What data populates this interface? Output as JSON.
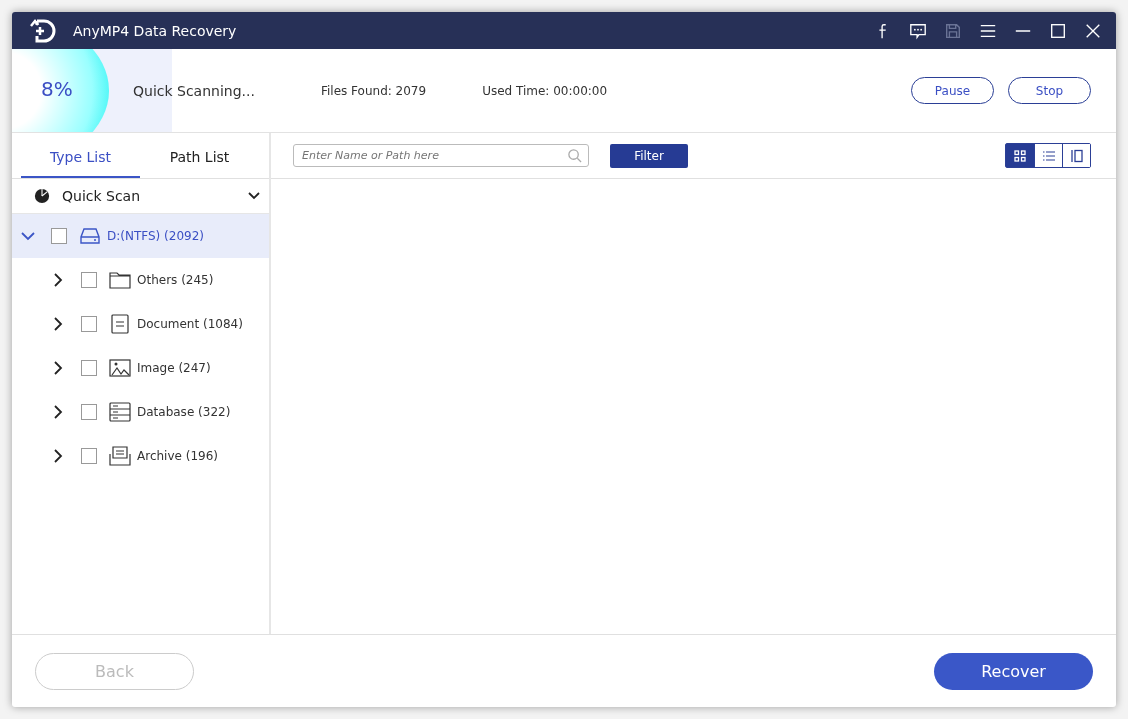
{
  "window": {
    "title": "AnyMP4 Data Recovery"
  },
  "scan": {
    "percent": "8%",
    "status": "Quick Scanning...",
    "files_found": "Files Found: 2079",
    "used_time": "Used Time: 00:00:00",
    "buttons": [
      "Pause",
      "Stop"
    ]
  },
  "tabs": [
    {
      "label": "Type List",
      "selected": true
    },
    {
      "label": "Path List",
      "selected": false
    }
  ],
  "scan_mode": {
    "label": "Quick Scan"
  },
  "tree": [
    {
      "kind": "drive",
      "label": "D:(NTFS) (2092)",
      "expanded": true,
      "selected": true,
      "checked": false,
      "children": [
        {
          "kind": "folder",
          "label": "Others (245)",
          "expanded": false,
          "selected": false,
          "checked": false
        },
        {
          "kind": "document",
          "label": "Document (1084)",
          "expanded": false,
          "selected": false,
          "checked": false
        },
        {
          "kind": "image",
          "label": "Image (247)",
          "expanded": false,
          "selected": false,
          "checked": false
        },
        {
          "kind": "database",
          "label": "Database (322)",
          "expanded": false,
          "selected": false,
          "checked": false
        },
        {
          "kind": "archive",
          "label": "Archive (196)",
          "expanded": false,
          "selected": false,
          "checked": false
        }
      ]
    }
  ],
  "search": {
    "placeholder": "Enter Name or Path here"
  },
  "filter_button": "Filter",
  "view_modes": [
    {
      "kind": "grid",
      "selected": true
    },
    {
      "kind": "list",
      "selected": false
    },
    {
      "kind": "preview",
      "selected": false
    }
  ],
  "footer": {
    "back": {
      "label": "Back",
      "disabled": true
    },
    "recover": "Recover"
  }
}
